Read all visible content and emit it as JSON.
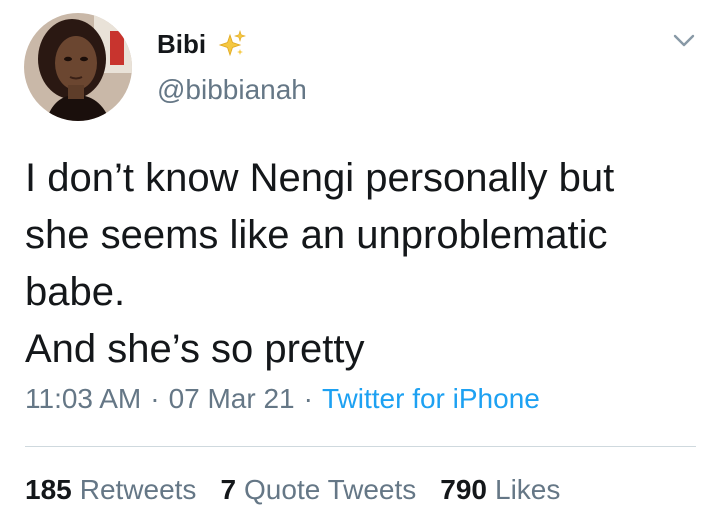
{
  "tweet": {
    "author": {
      "display_name": "Bibi",
      "name_emoji": "sparkles-icon",
      "handle": "@bibbianah",
      "avatar": "profile-photo"
    },
    "text": "I don’t know Nengi personally but\nshe seems like an unproblematic\nbabe.\nAnd she’s so pretty",
    "time": "11:03 AM",
    "date": "07 Mar 21",
    "separator": "·",
    "source": "Twitter for iPhone",
    "menu_icon": "chevron-down-icon",
    "stats": {
      "retweets": {
        "count": "185",
        "label": "Retweets"
      },
      "quote_tweets": {
        "count": "7",
        "label": "Quote Tweets"
      },
      "likes": {
        "count": "790",
        "label": "Likes"
      }
    }
  },
  "colors": {
    "text": "#14171a",
    "secondary": "#657786",
    "link": "#1da1f2",
    "sparkle": "#f5c842",
    "divider": "#cfd9de"
  }
}
